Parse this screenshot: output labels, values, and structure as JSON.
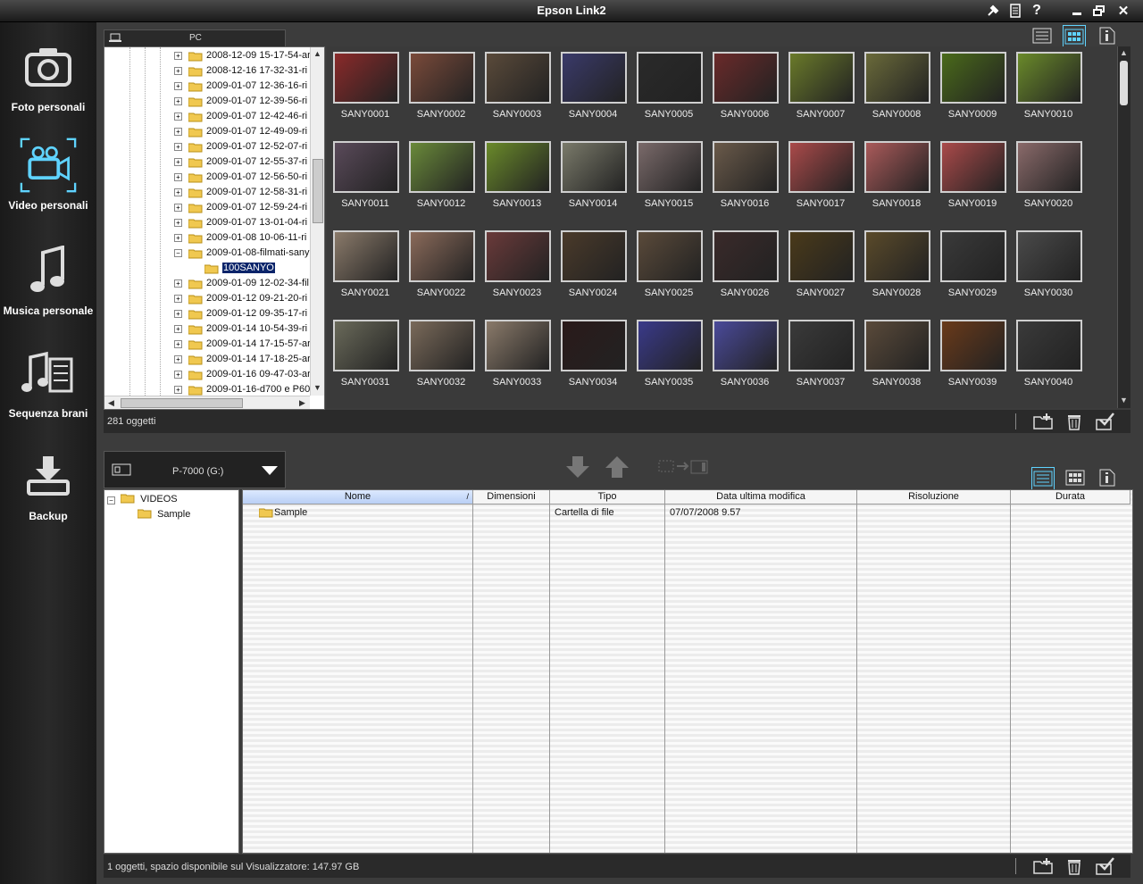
{
  "window": {
    "title": "Epson Link2"
  },
  "sidebar": {
    "items": [
      {
        "label": "Foto personali",
        "icon": "camera-icon"
      },
      {
        "label": "Video personali",
        "icon": "video-camera-icon",
        "selected": true
      },
      {
        "label": "Musica personale",
        "icon": "music-note-icon"
      },
      {
        "label": "Sequenza brani",
        "icon": "playlist-icon"
      },
      {
        "label": "Backup",
        "icon": "backup-download-icon"
      }
    ]
  },
  "top_panel": {
    "pc_tab_label": "PC",
    "tree_items": [
      "2008-12-09 15-17-54-ar",
      "2008-12-16 17-32-31-ri",
      "2009-01-07 12-36-16-ri",
      "2009-01-07 12-39-56-ri",
      "2009-01-07 12-42-46-ri",
      "2009-01-07 12-49-09-ri",
      "2009-01-07 12-52-07-ri",
      "2009-01-07 12-55-37-ri",
      "2009-01-07 12-56-50-ri",
      "2009-01-07 12-58-31-ri",
      "2009-01-07 12-59-24-ri",
      "2009-01-07 13-01-04-ri",
      "2009-01-08 10-06-11-ri",
      "2009-01-08-filmati-sany",
      "100SANYO",
      "2009-01-09 12-02-34-fil",
      "2009-01-12 09-21-20-ri",
      "2009-01-12 09-35-17-ri",
      "2009-01-14 10-54-39-ri",
      "2009-01-14 17-15-57-ar",
      "2009-01-14 17-18-25-ar",
      "2009-01-16 09-47-03-ar",
      "2009-01-16-d700 e P60"
    ],
    "thumbnails": [
      "SANY0001",
      "SANY0002",
      "SANY0003",
      "SANY0004",
      "SANY0005",
      "SANY0006",
      "SANY0007",
      "SANY0008",
      "SANY0009",
      "SANY0010",
      "SANY0011",
      "SANY0012",
      "SANY0013",
      "SANY0014",
      "SANY0015",
      "SANY0016",
      "SANY0017",
      "SANY0018",
      "SANY0019",
      "SANY0020",
      "SANY0021",
      "SANY0022",
      "SANY0023",
      "SANY0024",
      "SANY0025",
      "SANY0026",
      "SANY0027",
      "SANY0028",
      "SANY0029",
      "SANY0030",
      "SANY0031",
      "SANY0032",
      "SANY0033",
      "SANY0034",
      "SANY0035",
      "SANY0036",
      "SANY0037",
      "SANY0038",
      "SANY0039",
      "SANY0040"
    ],
    "thumb_colors": [
      "#8a2a2a",
      "#7a4a3a",
      "#5a4a3a",
      "#3a3a6a",
      "#2a2a2a",
      "#6a2a2a",
      "#6a7a2a",
      "#6a6a3a",
      "#4a6a1a",
      "#6a8a2a",
      "#5a4a5a",
      "#6a8a3a",
      "#6a8a2a",
      "#7a7a6a",
      "#7a6a6a",
      "#6a5a4a",
      "#aa4a4a",
      "#aa5a5a",
      "#aa4a4a",
      "#8a6a6a",
      "#8a7a6a",
      "#8a6a5a",
      "#6a3a3a",
      "#4a3a2a",
      "#5a4a3a",
      "#3a2a2a",
      "#4a3a1a",
      "#5a4a2a",
      "#3a3a3a",
      "#4a4a4a",
      "#6a6a5a",
      "#7a6a5a",
      "#8a7a6a",
      "#2a1a1a",
      "#3a3a8a",
      "#4a4a9a",
      "#3a3a3a",
      "#5a4a3a",
      "#6a3a1a",
      "#3a3a3a"
    ],
    "status": "281 oggetti"
  },
  "device": {
    "name": "P-7000 (G:)"
  },
  "bottom_panel": {
    "tree": [
      {
        "label": "VIDEOS"
      },
      {
        "label": "Sample"
      }
    ],
    "columns": [
      "Nome",
      "Dimensioni",
      "Tipo",
      "Data ultima modifica",
      "Risoluzione",
      "Durata"
    ],
    "rows": [
      {
        "name": "Sample",
        "size": "",
        "type": "Cartella di file",
        "modified": "07/07/2008 9.57",
        "resolution": "",
        "duration": ""
      }
    ],
    "status": "1 oggetti, spazio disponibile sul Visualizzatore: 147.97 GB"
  }
}
